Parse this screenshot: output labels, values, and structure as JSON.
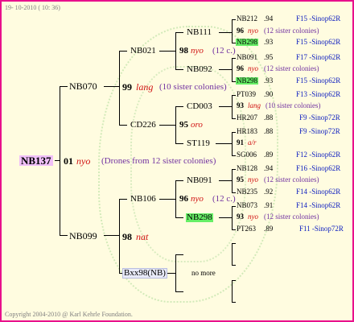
{
  "header": {
    "date": "19- 10-2010 ( 10: 36)"
  },
  "footer": {
    "copyright": "Copyright 2004-2010 @ Karl Kehrle Foundation."
  },
  "root": {
    "name": "NB137",
    "queen_num": "01",
    "code": "nyo",
    "note": "(Drones from 12 sister colonies)"
  },
  "gen1": [
    {
      "name": "NB070",
      "queen_num": "99",
      "code": "lang",
      "note": "(10 sister colonies)"
    },
    {
      "name": "NB099",
      "queen_num": "98",
      "code": "nat"
    }
  ],
  "gen2": {
    "nb021": {
      "name": "NB021",
      "queen_num": "98",
      "code": "nyo",
      "note": "(12 c.)"
    },
    "cd226": {
      "name": "CD226",
      "queen_num": "95",
      "code": "oro"
    },
    "nb106": {
      "name": "NB106",
      "queen_num": "96",
      "code": "nyo",
      "note": "(12 c.)"
    },
    "bxx98": {
      "name": "Bxx98(NB)",
      "note": "no more"
    }
  },
  "gen3": {
    "nb111": "NB111",
    "nb092": "NB092",
    "cd003": "CD003",
    "st119": "ST119",
    "nb091": "NB091",
    "nb298": "NB298"
  },
  "gen4": [
    {
      "name": "NB212",
      "val": ".94",
      "pedigree": "F15 -Sinop62R"
    },
    {
      "queen_num": "96",
      "code": "nyo",
      "note": "(12 sister colonies)"
    },
    {
      "name": "NB298",
      "val": ".93",
      "pedigree": "F15 -Sinop62R"
    },
    {
      "name": "NB091",
      "val": ".95",
      "pedigree": "F17 -Sinop62R"
    },
    {
      "queen_num": "96",
      "code": "nyo",
      "note": "(12 sister colonies)"
    },
    {
      "name": "NB298",
      "val": ".93",
      "pedigree": "F15 -Sinop62R"
    },
    {
      "name": "PT039",
      "val": ".90",
      "pedigree": "F13 -Sinop62R"
    },
    {
      "queen_num": "93",
      "code": "lang",
      "note": "(10 sister colonies)"
    },
    {
      "name": "HR207",
      "val": ".88",
      "pedigree": "F9 -Sinop72R"
    },
    {
      "name": "HR183",
      "val": ".88",
      "pedigree": "F9 -Sinop72R"
    },
    {
      "queen_num": "91",
      "code": "a/r"
    },
    {
      "name": "SG006",
      "val": ".89",
      "pedigree": "F12 -Sinop62R"
    },
    {
      "name": "NB128",
      "val": ".94",
      "pedigree": "F16 -Sinop62R"
    },
    {
      "queen_num": "95",
      "code": "nyo",
      "note": "(12 sister colonies)"
    },
    {
      "name": "NB235",
      "val": ".92",
      "pedigree": "F14 -Sinop62R"
    },
    {
      "name": "NB073",
      "val": ".91",
      "pedigree": "F14 -Sinop62R"
    },
    {
      "queen_num": "93",
      "code": "nyo",
      "note": "(12 sister colonies)"
    },
    {
      "name": "PT263",
      "val": ".89",
      "pedigree": "F11 -Sinop72R"
    }
  ]
}
